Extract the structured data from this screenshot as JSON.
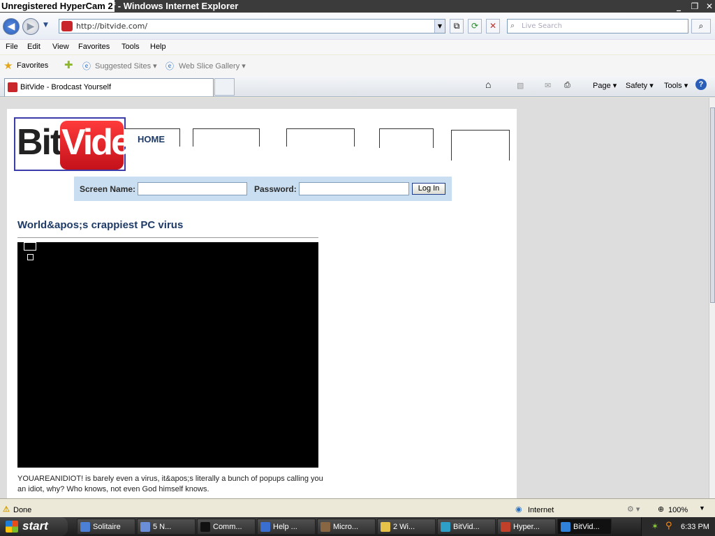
{
  "recorder_watermark": "Unregistered HyperCam 2",
  "window": {
    "title": "BitVide - Brodcast Yourself - Windows Internet Explorer",
    "title_visible": "elf - Windows Internet Explorer",
    "minimize": "_",
    "restore": "❐",
    "close": "✕"
  },
  "nav": {
    "back_icon": "◀",
    "forward_icon": "▶",
    "address": "http://bitvide.com/",
    "search_placeholder": "Live Search"
  },
  "menu": [
    "File",
    "Edit",
    "View",
    "Favorites",
    "Tools",
    "Help"
  ],
  "favorites_bar": {
    "favorites_label": "Favorites",
    "suggested_sites": "Suggested Sites ▾",
    "web_slice_gallery": "Web Slice Gallery ▾"
  },
  "tab": {
    "label": "BitVide - Brodcast Yourself"
  },
  "command_bar": {
    "page": "Page ▾",
    "safety": "Safety ▾",
    "tools": "Tools ▾",
    "help_icon": "?"
  },
  "site": {
    "logo_left": "Bit",
    "logo_right": "Vide",
    "nav_home": "HOME",
    "login": {
      "screen_name_label": "Screen Name:",
      "password_label": "Password:",
      "button": "Log In",
      "screen_name_value": "",
      "password_value": ""
    },
    "video_title": "World&apos;s crappiest PC virus",
    "video_description": "YOUAREANIDIOT! is barely even a virus, it&apos;s literally a bunch of popups calling you an idiot, why? Who knows, not even God himself knows."
  },
  "status": {
    "left": "Done",
    "zone": "Internet",
    "zoom": "100%"
  },
  "taskbar": {
    "start": "start",
    "items": [
      {
        "label": "Solitaire",
        "icon_color": "#4c7fd6"
      },
      {
        "label": "5 N...",
        "icon_color": "#6a8fd8"
      },
      {
        "label": "Comm...",
        "icon_color": "#111111"
      },
      {
        "label": "Help ...",
        "icon_color": "#3a6fd0"
      },
      {
        "label": "Micro...",
        "icon_color": "#886644"
      },
      {
        "label": "2 Wi...",
        "icon_color": "#e7c24a"
      },
      {
        "label": "BitVid...",
        "icon_color": "#2ea0c8"
      },
      {
        "label": "Hyper...",
        "icon_color": "#c0402a"
      },
      {
        "label": "BitVid...",
        "icon_color": "#2f82d8"
      }
    ],
    "clock": "6:33 PM"
  },
  "colors": {
    "brand_red": "#c4111a",
    "heading_blue": "#1e3a66",
    "login_bar_bg": "#c9def0"
  }
}
